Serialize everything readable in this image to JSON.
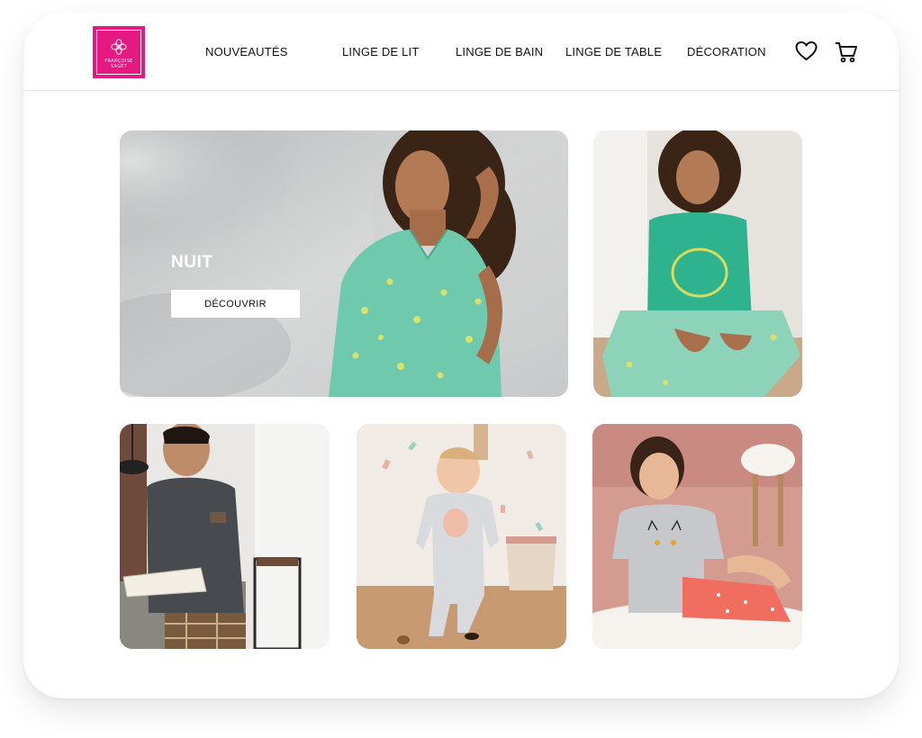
{
  "brand": {
    "logo_lines": [
      "FRANÇOISE",
      "SAGET"
    ],
    "color": "#e5197f"
  },
  "nav": {
    "items": [
      "NOUVEAUTÉS",
      "LINGE DE LIT",
      "LINGE DE BAIN",
      "LINGE DE TABLE",
      "DÉCORATION"
    ]
  },
  "icons": {
    "wishlist": "heart-icon",
    "cart": "cart-icon"
  },
  "hero": {
    "title": "NUIT",
    "button_label": "DÉCOUVRIR"
  }
}
